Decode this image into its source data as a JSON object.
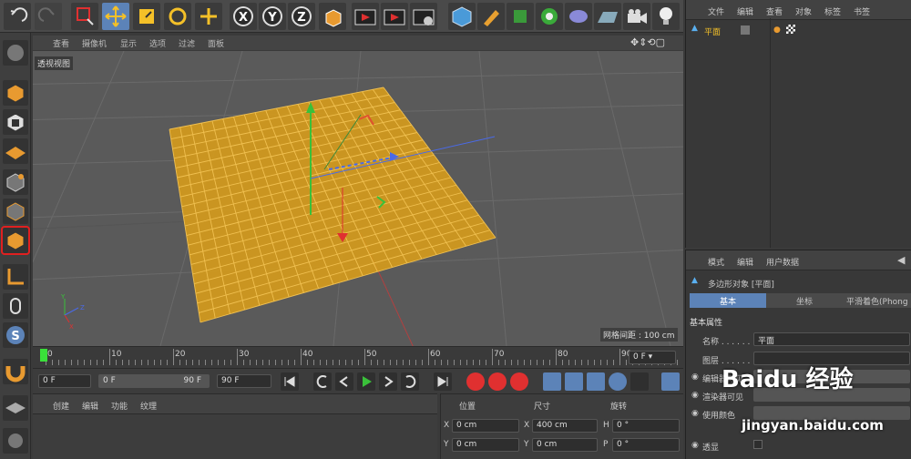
{
  "vp_menu": [
    "查看",
    "摄像机",
    "显示",
    "选项",
    "过滤",
    "面板"
  ],
  "viewport": {
    "label": "透视视图",
    "grid_spacing": "网格间距 : 100 cm"
  },
  "timeline": {
    "ticks": [
      "0",
      "10",
      "20",
      "30",
      "40",
      "50",
      "60",
      "70",
      "80",
      "90"
    ],
    "end_frame": "0 F",
    "current": 0
  },
  "transport": {
    "start": "0 F",
    "range_start": "0 F",
    "range_end": "90 F",
    "end": "90 F"
  },
  "mat_menu": [
    "创建",
    "编辑",
    "功能",
    "纹理"
  ],
  "coords": {
    "headers": [
      "位置",
      "尺寸",
      "旋转"
    ],
    "rows": [
      {
        "a": "X",
        "pos": "0 cm",
        "sizeLabel": "X",
        "size": "400 cm",
        "rotLabel": "H",
        "rot": "0 °"
      },
      {
        "a": "Y",
        "pos": "0 cm",
        "sizeLabel": "Y",
        "size": "0 cm",
        "rotLabel": "P",
        "rot": "0 °"
      }
    ]
  },
  "obj_menu": [
    "文件",
    "编辑",
    "查看",
    "对象",
    "标签",
    "书签"
  ],
  "obj_tree": {
    "name": "平面"
  },
  "attr_menu": [
    "模式",
    "编辑",
    "用户数据"
  ],
  "attr": {
    "title": "多边形对象 [平面]",
    "tabs": [
      "基本",
      "坐标",
      "平滑着色(Phong"
    ],
    "section": "基本属性",
    "rows": [
      {
        "label": "名称 . . . . . .",
        "value": "平面"
      },
      {
        "label": "图层 . . . . . .",
        "value": ""
      },
      {
        "label": "编辑器可见",
        "value": ""
      },
      {
        "label": "渲染器可见",
        "value": ""
      },
      {
        "label": "使用颜色",
        "value": ""
      },
      {
        "label": "透显",
        "value": ""
      }
    ]
  },
  "watermark": {
    "brand": "Baidu",
    "cn": "经验",
    "url": "jingyan.baidu.com"
  },
  "colors": {
    "accent": "#5c83b8",
    "plane": "#d49a1c",
    "plane_line": "#e8b642",
    "highlight_box": "#e02020"
  },
  "icons": [
    "undo-icon",
    "redo-icon",
    "select-icon",
    "move-icon",
    "scale-icon",
    "rotate-icon",
    "axis-x-icon",
    "axis-y-icon",
    "axis-z-icon",
    "coord-icon",
    "render-icon",
    "cube-icon",
    "pen-icon",
    "light-icon",
    "camera-icon",
    "bulb-icon"
  ]
}
